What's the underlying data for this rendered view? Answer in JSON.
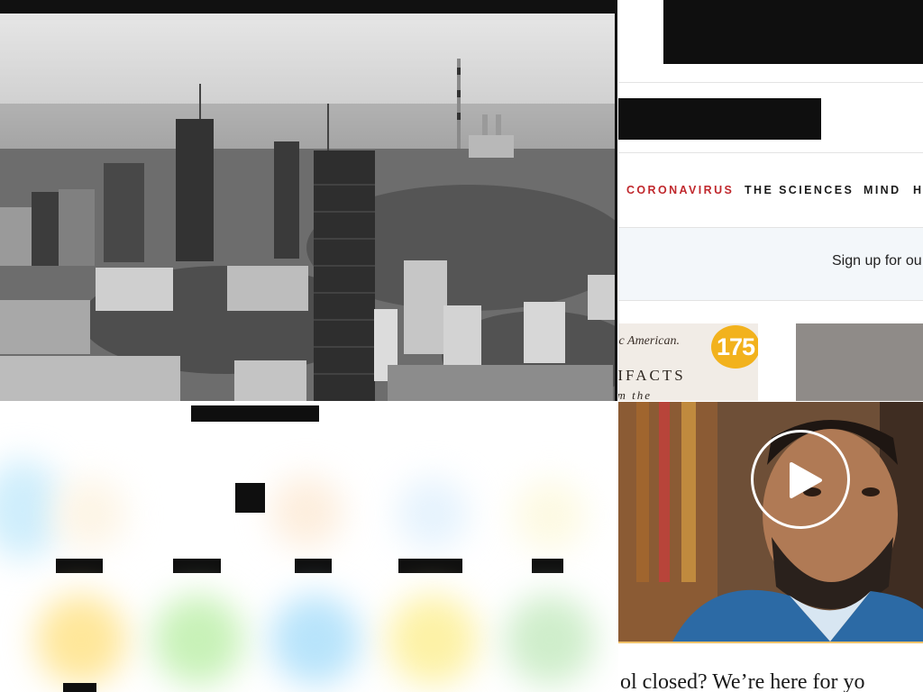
{
  "nav": {
    "items": [
      {
        "label": "CORONAVIRUS",
        "accent": true
      },
      {
        "label": "THE SCIENCES",
        "accent": false
      },
      {
        "label": "MIND",
        "accent": false
      },
      {
        "label": "H",
        "accent": false
      }
    ]
  },
  "newsletter": {
    "text": "Sign up for ou"
  },
  "promo": {
    "brand": "ntific American.",
    "badge": "175",
    "title": "TIFACTS",
    "subtitle": "om the"
  },
  "headline": {
    "text": "ol closed? We’re here for yo"
  },
  "icons": {
    "video_play": "play-icon",
    "loading": "spinner-icon"
  },
  "colors": {
    "accent_red": "#c0282d",
    "nav_text": "#1a1a1a",
    "signup_band": "#f3f7fa",
    "badge": "#f2b21d",
    "redaction": "#0f0f0f"
  }
}
